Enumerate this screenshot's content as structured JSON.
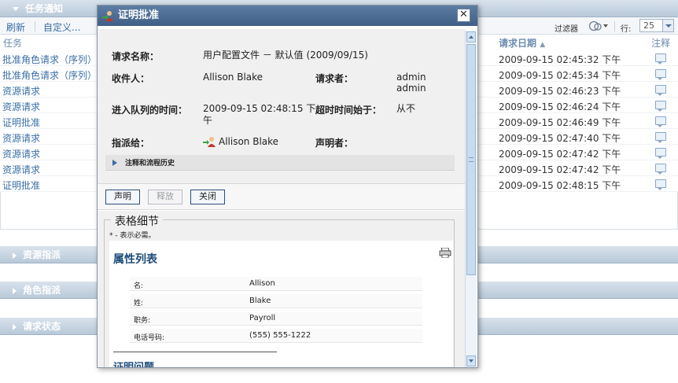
{
  "background": {
    "task_panel": {
      "title": "任务通知",
      "toolbar": {
        "refresh": "刷新",
        "customize": "自定义...",
        "filter": "过滤器",
        "rows_label": "行:",
        "rows_value": "25"
      },
      "columns": {
        "type": "任务",
        "request_date": "请求日期",
        "note": "注释"
      },
      "rows": [
        {
          "type": "批准角色请求（序列）",
          "date": "2009-09-15 02:45:32 下午"
        },
        {
          "type": "批准角色请求（序列）",
          "date": "2009-09-15 02:45:34 下午"
        },
        {
          "type": "资源请求",
          "date": "2009-09-15 02:46:23 下午"
        },
        {
          "type": "资源请求",
          "date": "2009-09-15 02:46:24 下午"
        },
        {
          "type": "证明批准",
          "date": "2009-09-15 02:46:49 下午"
        },
        {
          "type": "资源请求",
          "date": "2009-09-15 02:47:40 下午"
        },
        {
          "type": "资源请求",
          "date": "2009-09-15 02:47:42 下午"
        },
        {
          "type": "资源请求",
          "date": "2009-09-15 02:47:42 下午"
        },
        {
          "type": "证明批准",
          "date": "2009-09-15 02:48:15 下午"
        }
      ]
    },
    "sections": [
      "资源指派",
      "角色指派",
      "请求状态"
    ]
  },
  "dialog": {
    "title": "证明批准",
    "info": {
      "request_name_label": "请求名称：",
      "request_name_value": "用户配置文件 － 默认值 (2009/09/15)",
      "recipient_label": "收件人：",
      "recipient_value": "Allison Blake",
      "requester_label": "请求者：",
      "requester_value_1": "admin",
      "requester_value_2": "admin",
      "queued_label": "进入队列的时间：",
      "queued_value_1": "2009-09-15 02:48:15 下",
      "queued_value_2": "午",
      "timeout_label": "超时时间始于：",
      "timeout_value": "从不",
      "assigned_label": "指派给：",
      "assigned_value": "Allison Blake",
      "claimer_label": "声明者：",
      "history_label": "注释和流程历史"
    },
    "buttons": {
      "claim": "声明",
      "release": "释放",
      "close": "关闭"
    },
    "form": {
      "legend": "表格细节",
      "required_note": "* - 表示必需。",
      "section_title": "属性列表",
      "fields": [
        {
          "label": "名:",
          "value": "Allison"
        },
        {
          "label": "姓:",
          "value": "Blake"
        },
        {
          "label": "职务:",
          "value": "Payroll"
        },
        {
          "label": "电话号码:",
          "value": "(555) 555-1222"
        }
      ],
      "next_section_title": "证明问题"
    }
  }
}
